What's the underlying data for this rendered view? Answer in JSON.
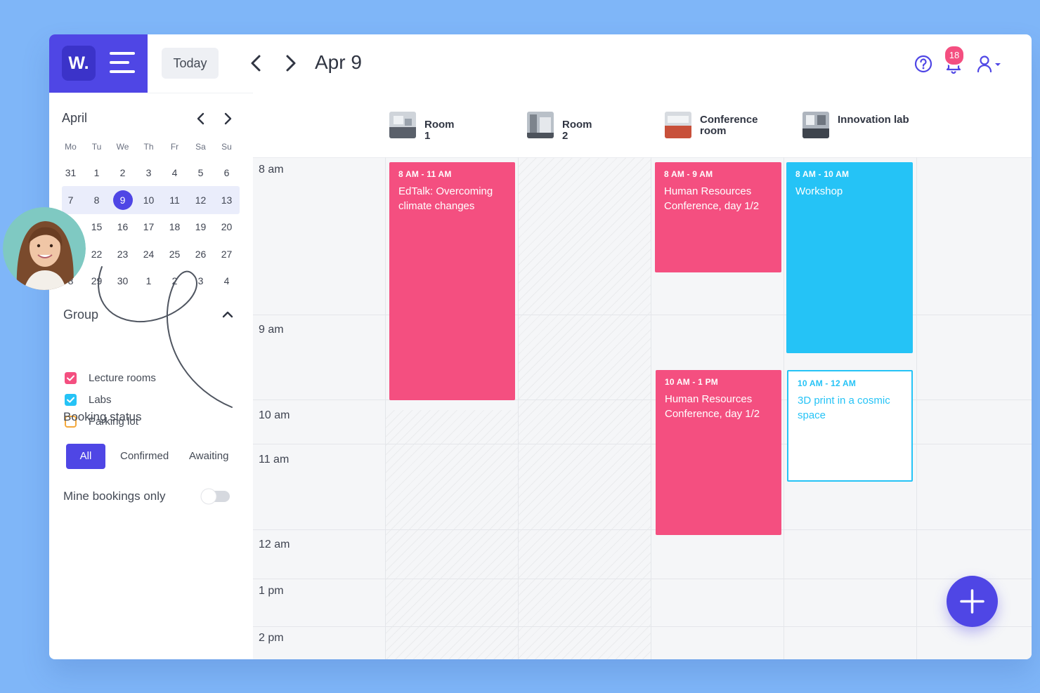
{
  "app": {
    "logo_text": "W.",
    "brand_color": "#4f46e5"
  },
  "toolbar": {
    "today_label": "Today",
    "current_date": "Apr 9",
    "notification_count": "18"
  },
  "mini_calendar": {
    "month": "April",
    "weekdays": [
      "Mo",
      "Tu",
      "We",
      "Th",
      "Fr",
      "Sa",
      "Su"
    ],
    "weeks": [
      [
        "31",
        "1",
        "2",
        "3",
        "4",
        "5",
        "6"
      ],
      [
        "7",
        "8",
        "9",
        "10",
        "11",
        "12",
        "13"
      ],
      [
        "",
        "15",
        "16",
        "17",
        "18",
        "19",
        "20"
      ],
      [
        "",
        "22",
        "23",
        "24",
        "25",
        "26",
        "27"
      ],
      [
        "8",
        "29",
        "30",
        "1",
        "2",
        "3",
        "4"
      ]
    ],
    "selected_day": "9"
  },
  "filters": {
    "group_title": "Group",
    "groups": [
      {
        "label": "Lecture rooms",
        "checked": true,
        "color": "#f44f80"
      },
      {
        "label": "Labs",
        "checked": true,
        "color": "#25c3f6"
      },
      {
        "label": "Parking lot",
        "checked": false,
        "color": "#f3a83b"
      }
    ],
    "booking_status_title": "Booking status",
    "statuses": [
      "All",
      "Confirmed",
      "Awaiting"
    ],
    "active_status": "All",
    "mine_only_label": "Mine bookings only",
    "mine_only_on": false
  },
  "rooms": [
    {
      "name": "Room 1"
    },
    {
      "name": "Room 2"
    },
    {
      "name": "Conference room"
    },
    {
      "name": "Innovation lab"
    }
  ],
  "time_slots": [
    "8 am",
    "9 am",
    "10 am",
    "11 am",
    "12 am",
    "1 pm",
    "2 pm"
  ],
  "events": [
    {
      "time": "8 AM - 11 AM",
      "title": "EdTalk: Overcoming climate changes",
      "room": "Room 1",
      "style": "pink"
    },
    {
      "time": "8 AM - 9 AM",
      "title": "Human Resources Conference, day 1/2",
      "room": "Conference room",
      "style": "pink"
    },
    {
      "time": "8 AM - 10 AM",
      "title": "Workshop",
      "room": "Innovation lab",
      "style": "cyan"
    },
    {
      "time": "10 AM - 1 PM",
      "title": "Human Resources Conference, day 1/2",
      "room": "Conference room",
      "style": "pink"
    },
    {
      "time": "10 AM - 12 AM",
      "title": "3D print in a cosmic space",
      "room": "Innovation lab",
      "style": "cyan-outline"
    }
  ],
  "colors": {
    "pink": "#f44f80",
    "cyan": "#25c3f6",
    "background": "#7fb6f8"
  }
}
